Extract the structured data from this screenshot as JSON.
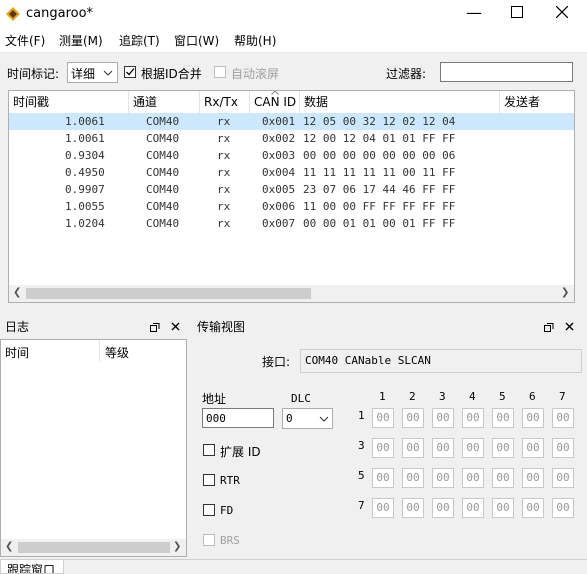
{
  "window": {
    "title": "cangaroo*"
  },
  "menu": [
    "文件(F)",
    "测量(M)",
    "追踪(T)",
    "窗口(W)",
    "帮助(H)"
  ],
  "toolbar": {
    "timestamp_label": "时间标记:",
    "timestamp_value": "详细",
    "aggregate_label": "根据ID合并",
    "aggregate_checked": true,
    "autoscroll_label": "自动滚屏",
    "autoscroll_checked": false,
    "filter_label": "过滤器:",
    "filter_value": ""
  },
  "trace": {
    "columns": [
      "时间戳",
      "通道",
      "Rx/Tx",
      "CAN ID",
      "数据",
      "发送者"
    ],
    "rows": [
      {
        "time": "1.0061",
        "channel": "COM40",
        "dir": "rx",
        "id": "0x001",
        "data": "12 05 00 32 12 02 12 04"
      },
      {
        "time": "1.0061",
        "channel": "COM40",
        "dir": "rx",
        "id": "0x002",
        "data": "12 00 12 04 01 01 FF FF"
      },
      {
        "time": "0.9304",
        "channel": "COM40",
        "dir": "rx",
        "id": "0x003",
        "data": "00 00 00 00 00 00 00 06"
      },
      {
        "time": "0.4950",
        "channel": "COM40",
        "dir": "rx",
        "id": "0x004",
        "data": "11 11 11 11 11 00 11 FF"
      },
      {
        "time": "0.9907",
        "channel": "COM40",
        "dir": "rx",
        "id": "0x005",
        "data": "23 07 06 17 44 46 FF FF"
      },
      {
        "time": "1.0055",
        "channel": "COM40",
        "dir": "rx",
        "id": "0x006",
        "data": "11 00 00 FF FF FF FF FF"
      },
      {
        "time": "1.0204",
        "channel": "COM40",
        "dir": "rx",
        "id": "0x007",
        "data": "00 00 01 01 00 01 FF FF"
      }
    ]
  },
  "log_panel": {
    "title": "日志",
    "columns": [
      "时间",
      "等级"
    ]
  },
  "tx_panel": {
    "title": "传输视图",
    "interface_label": "接口:",
    "interface_value": "COM40 CANable SLCAN",
    "address_label": "地址",
    "address_value": "000",
    "dlc_label": "DLC",
    "dlc_value": "0",
    "byte_headers": [
      "1",
      "2",
      "3",
      "4",
      "5",
      "6",
      "7"
    ],
    "row_labels": [
      "1",
      "3",
      "5",
      "7"
    ],
    "byte_placeholder": "00",
    "ext_label": "扩展 ID",
    "rtr_label": "RTR",
    "fd_label": "FD",
    "brs_label": "BRS"
  },
  "bottom_tab": "跟踪窗口"
}
